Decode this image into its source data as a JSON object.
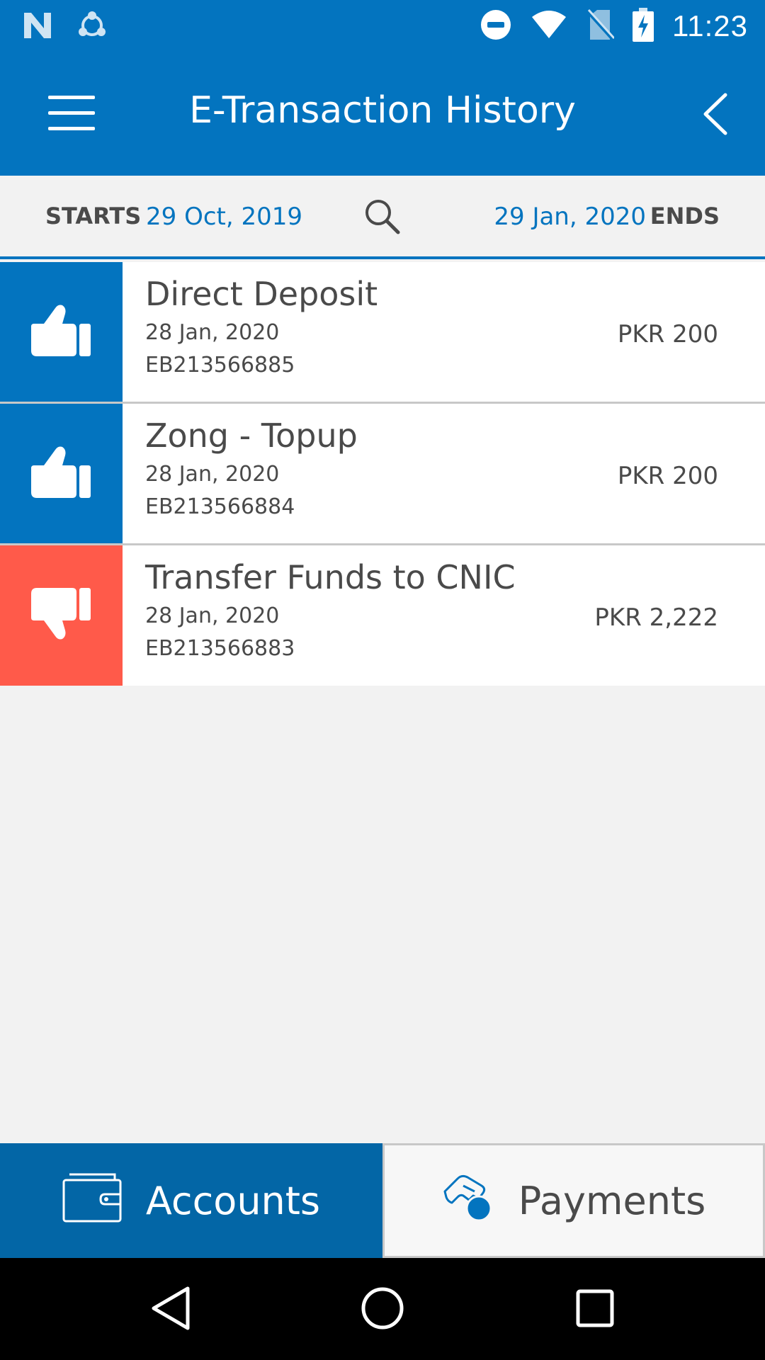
{
  "status_bar": {
    "time": "11:23",
    "icons": [
      "n-notification-icon",
      "share-sync-icon",
      "do-not-disturb-icon",
      "wifi-icon",
      "no-sim-icon",
      "battery-charging-icon"
    ]
  },
  "header": {
    "title": "E-Transaction History",
    "menu_icon": "hamburger-menu-icon",
    "back_icon": "chevron-left-icon"
  },
  "date_range": {
    "starts_label": "STARTS",
    "starts_value": "29 Oct, 2019",
    "ends_label": "ENDS",
    "ends_value": "29 Jan, 2020",
    "search_icon": "search-icon"
  },
  "transactions": [
    {
      "name": "Direct Deposit",
      "date": "28 Jan, 2020",
      "ref": "EB213566885",
      "amount": "PKR 200",
      "status": "success",
      "icon": "thumbs-up-icon"
    },
    {
      "name": "Zong - Topup",
      "date": "28 Jan, 2020",
      "ref": "EB213566884",
      "amount": "PKR 200",
      "status": "success",
      "icon": "thumbs-up-icon"
    },
    {
      "name": "Transfer Funds to CNIC",
      "date": "28 Jan, 2020",
      "ref": "EB213566883",
      "amount": "PKR 2,222",
      "status": "failed",
      "icon": "thumbs-down-icon"
    }
  ],
  "tabs": {
    "accounts_label": "Accounts",
    "payments_label": "Payments"
  },
  "colors": {
    "primary": "#0374bf",
    "success": "#0374bf",
    "failed": "#ff5a4a",
    "tab_active": "#0366a6"
  }
}
